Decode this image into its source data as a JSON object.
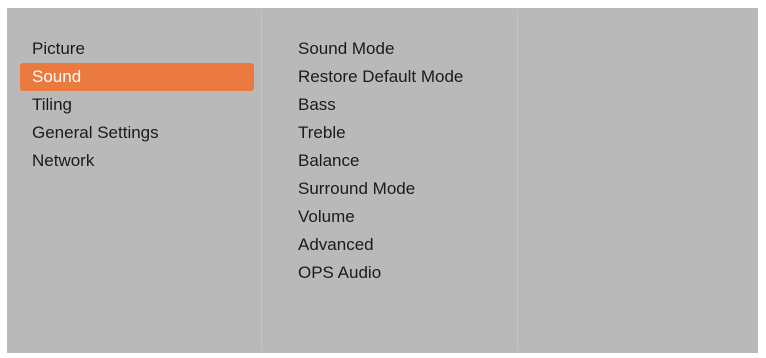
{
  "colors": {
    "panel_background": "#b9b9b9",
    "selection_highlight": "#ea7a3f",
    "text": "#1a1a1a",
    "selected_text": "#ffffff"
  },
  "main_menu": {
    "items": [
      {
        "label": "Picture"
      },
      {
        "label": "Sound"
      },
      {
        "label": "Tiling"
      },
      {
        "label": "General Settings"
      },
      {
        "label": "Network"
      }
    ],
    "selected": "Sound"
  },
  "sound_menu": {
    "items": [
      {
        "label": "Sound Mode"
      },
      {
        "label": "Restore Default Mode"
      },
      {
        "label": "Bass"
      },
      {
        "label": "Treble"
      },
      {
        "label": "Balance"
      },
      {
        "label": "Surround Mode"
      },
      {
        "label": "Volume"
      },
      {
        "label": "Advanced"
      },
      {
        "label": "OPS Audio"
      }
    ]
  }
}
